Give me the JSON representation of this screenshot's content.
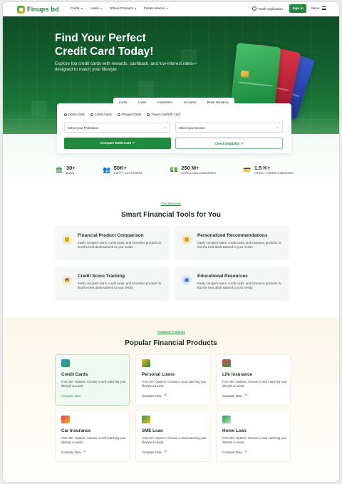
{
  "nav": {
    "logo": "Finups bd",
    "items": [
      {
        "label": "Cards"
      },
      {
        "label": "Loans"
      },
      {
        "label": "Others Products"
      },
      {
        "label": "Fintips Islamic"
      }
    ],
    "track_application": "Track Application",
    "sign_in": "Sign in",
    "menu": "Menu"
  },
  "hero": {
    "title_line1": "Find Your Perfect",
    "title_line2": "Credit Card Today!",
    "subtitle": "Explore top credit cards with rewards, cashback, and low-interest rates—designed to match your lifestyle."
  },
  "search": {
    "tabs": [
      "Cards",
      "Loans",
      "Investment",
      "Accounts",
      "Bima/ Insurance"
    ],
    "radios": [
      "Debit Cards",
      "Credit Cards",
      "Prepaid Cards",
      "Travel Card/Gift Card"
    ],
    "profession_placeholder": "Select your Profession",
    "income_placeholder": "Select your Income",
    "compare_button": "Compare Debit Card",
    "eligibility_button": "Check Eligibility"
  },
  "stats": [
    {
      "value": "30+",
      "label": "Banks",
      "icon": "bank-icon"
    },
    {
      "value": "50K+",
      "label": "HAPPY CUSTOMERS",
      "icon": "users-icon"
    },
    {
      "value": "250 M+",
      "label": "CORE LOAN DISBURSED",
      "icon": "money-icon"
    },
    {
      "value": "1.5 K+",
      "label": "CREDIT CARDS DISBURSED",
      "icon": "card-icon"
    }
  ],
  "services": {
    "eyebrow": "Our Services",
    "title": "Smart Financial Tools for You",
    "items": [
      {
        "title": "Financial Product Comparison",
        "desc": "Easily compare loans, credit cards, and insurance products to find the best deals tailored to your needs."
      },
      {
        "title": "Personalized Recommendations",
        "desc": "Easily compare loans, credit cards, and insurance products to find the best deals tailored to your needs."
      },
      {
        "title": "Credit Score Tracking",
        "desc": "Easily compare loans, credit cards, and insurance products to find the best deals tailored to your needs."
      },
      {
        "title": "Educational Resources",
        "desc": "Easily compare loans, credit cards, and insurance products to find the best deals tailored to your needs."
      }
    ]
  },
  "products": {
    "eyebrow": "Featured Products",
    "title": "Popular Financial Products",
    "items": [
      {
        "title": "Credit Cards",
        "desc": "From 50+ Options, Choose a card matching your lifestyle & needs",
        "link": "Compare Now"
      },
      {
        "title": "Personal Loans",
        "desc": "From 50+ Options, Choose a card matching your lifestyle & needs",
        "link": "Compare Now"
      },
      {
        "title": "Life Insurance",
        "desc": "From 50+ Options, Choose a card matching your lifestyle & needs",
        "link": "Compare Now"
      },
      {
        "title": "Car Insurance",
        "desc": "From 50+ Options, Choose a card matching your lifestyle & needs",
        "link": "Compare Now"
      },
      {
        "title": "SME Loan",
        "desc": "From 50+ Options, Choose a card matching your lifestyle & needs",
        "link": "Compare Now"
      },
      {
        "title": "Home Loan",
        "desc": "From 50+ Options, Choose a card matching your lifestyle & needs",
        "link": "Compare Now"
      }
    ]
  },
  "colors": {
    "primary": "#1f8a3b",
    "hero_dark": "#0f4d27",
    "accent_gold": "#f2b221"
  }
}
